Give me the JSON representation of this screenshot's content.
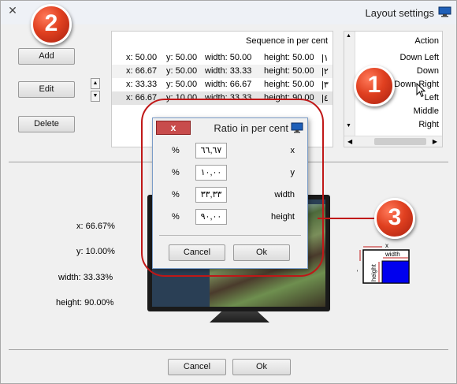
{
  "window": {
    "title": "Layout settings",
    "close_glyph": "✕"
  },
  "buttons": {
    "add": "Add",
    "edit": "Edit",
    "delete": "Delete",
    "up": "▲",
    "down": "▼",
    "cancel": "Cancel",
    "ok": "Ok"
  },
  "sequence": {
    "header": "Sequence in per cent",
    "rows": [
      {
        "x": "x: 50.00",
        "y": "y: 50.00",
        "w": "width: 50.00",
        "h": "height: 50.00",
        "n": "|١"
      },
      {
        "x": "x: 66.67",
        "y": "y: 50.00",
        "w": "width: 33.33",
        "h": "height: 50.00",
        "n": "|٢"
      },
      {
        "x": "x: 33.33",
        "y": "y: 50.00",
        "w": "width: 66.67",
        "h": "height: 50.00",
        "n": "|٣"
      },
      {
        "x": "x: 66.67",
        "y": "y: 10.00",
        "w": "width: 33.33",
        "h": "height: 90.00",
        "n": "|٤"
      }
    ]
  },
  "actions": {
    "header": "Action",
    "items": [
      "Down Left",
      "Down",
      "Down Right",
      "Left",
      "Middle",
      "Right"
    ],
    "scroll_up": "▲",
    "scroll_down": "▼",
    "scroll_left": "◀",
    "scroll_right": "▶"
  },
  "details": {
    "x": "x: 66.67%",
    "y": "y: 10.00%",
    "width": "width: 33.33%",
    "height": "height: 90.00%"
  },
  "dialog": {
    "close_glyph": "x",
    "title": "Ratio in per cent",
    "rows": [
      {
        "pct": "%",
        "value": "٦٦,٦٧",
        "name": "x"
      },
      {
        "pct": "%",
        "value": "١٠,٠٠",
        "name": "y"
      },
      {
        "pct": "%",
        "value": "٣٣,٣٣",
        "name": "width"
      },
      {
        "pct": "%",
        "value": "٩٠,٠٠",
        "name": "height"
      }
    ],
    "cancel": "Cancel",
    "ok": "Ok"
  },
  "callouts": [
    "1",
    "2",
    "3"
  ],
  "diagram": {
    "x": "x",
    "y": "y",
    "width": "width",
    "height": "height"
  },
  "colors": {
    "accent_red": "#c01818",
    "diagram_fill": "#0000ee"
  }
}
